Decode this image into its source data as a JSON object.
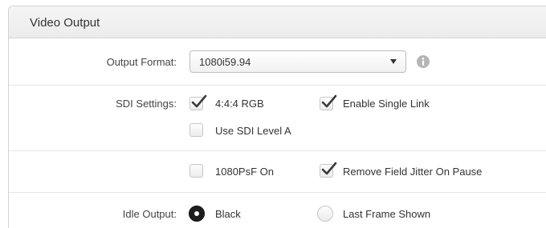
{
  "panel": {
    "title": "Video Output"
  },
  "output_format": {
    "label": "Output Format:",
    "selected": "1080i59.94"
  },
  "sdi_settings": {
    "label": "SDI Settings:",
    "options": [
      {
        "label": "4:4:4 RGB",
        "checked": true
      },
      {
        "label": "Enable Single Link",
        "checked": true
      },
      {
        "label": "Use SDI Level A",
        "checked": false
      }
    ]
  },
  "field_options": {
    "options": [
      {
        "label": "1080PsF On",
        "checked": false
      },
      {
        "label": "Remove Field Jitter On Pause",
        "checked": true
      }
    ]
  },
  "idle_output": {
    "label": "Idle Output:",
    "options": [
      {
        "label": "Black",
        "selected": true
      },
      {
        "label": "Last Frame Shown",
        "selected": false
      }
    ]
  },
  "icons": {
    "dropdown": "chevron-down-icon",
    "info": "info-icon",
    "check": "checkmark-icon"
  },
  "colors": {
    "check": "#3a3a3a",
    "info_icon": "#b5b5b5",
    "radio_selected": "#1e1e1e"
  }
}
